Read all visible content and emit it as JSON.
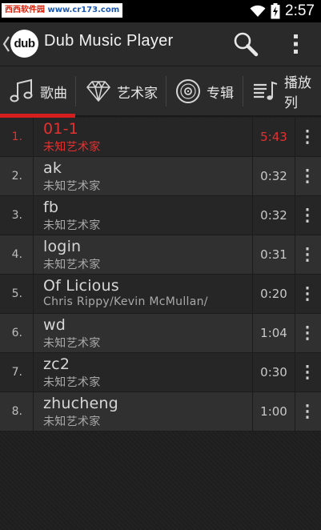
{
  "status_bar": {
    "watermark_brand": "西西软件园",
    "watermark_url": "www.cr173.com",
    "time": "2:57",
    "icons": [
      "wifi-icon",
      "battery-charging-icon"
    ]
  },
  "action_bar": {
    "logo_text": "dub",
    "title": "Dub Music Player",
    "icons": [
      "back-chevron-icon",
      "search-icon",
      "overflow-menu-icon"
    ]
  },
  "tabs": [
    {
      "label": "歌曲",
      "icon": "music-note-icon"
    },
    {
      "label": "艺术家",
      "icon": "diamond-icon"
    },
    {
      "label": "专辑",
      "icon": "vinyl-disc-icon"
    },
    {
      "label": "播放列",
      "icon": "playlist-icon"
    }
  ],
  "colors": {
    "accent": "#d51e1e",
    "active_text": "#e53030"
  },
  "songs": [
    {
      "index": "1.",
      "title": "01-1",
      "artist": "未知艺术家",
      "duration": "5:43",
      "active": true
    },
    {
      "index": "2.",
      "title": "ak",
      "artist": "未知艺术家",
      "duration": "0:32"
    },
    {
      "index": "3.",
      "title": "fb",
      "artist": "未知艺术家",
      "duration": "0:32"
    },
    {
      "index": "4.",
      "title": "login",
      "artist": "未知艺术家",
      "duration": "0:31"
    },
    {
      "index": "5.",
      "title": "Of Licious",
      "artist": "Chris Rippy/Kevin McMullan/",
      "duration": "0:20"
    },
    {
      "index": "6.",
      "title": "wd",
      "artist": "未知艺术家",
      "duration": "1:04"
    },
    {
      "index": "7.",
      "title": "zc2",
      "artist": "未知艺术家",
      "duration": "0:30"
    },
    {
      "index": "8.",
      "title": "zhucheng",
      "artist": "未知艺术家",
      "duration": "1:00"
    }
  ]
}
